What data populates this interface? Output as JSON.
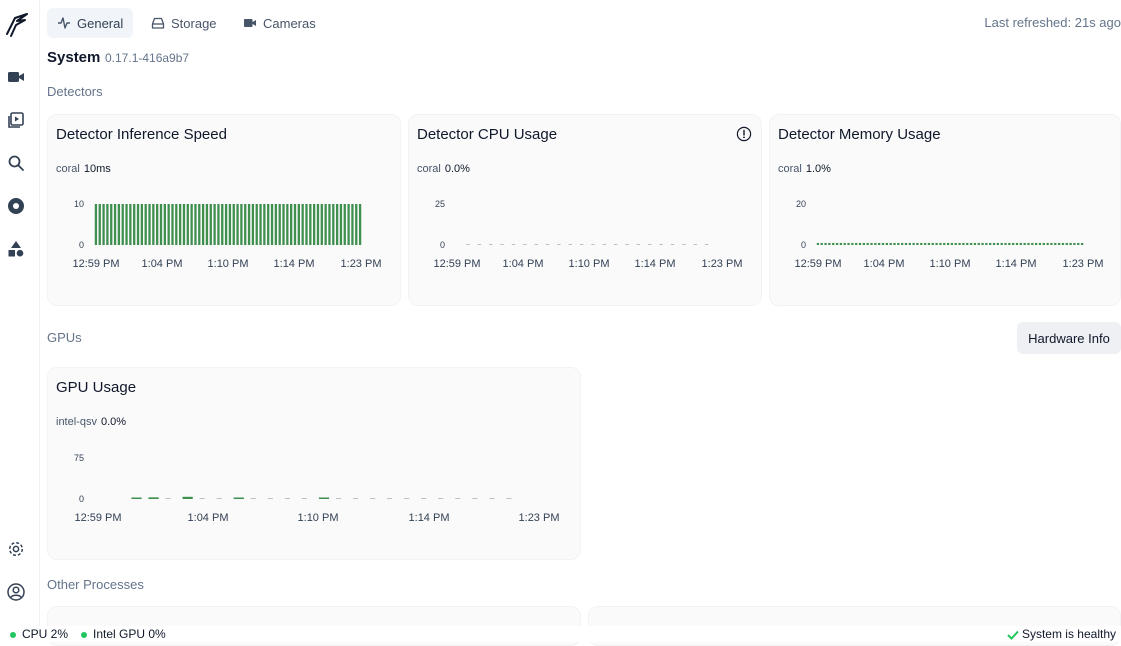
{
  "tabs": [
    {
      "label": "General",
      "icon": "activity-icon",
      "active": true
    },
    {
      "label": "Storage",
      "icon": "hard-drive-icon",
      "active": false
    },
    {
      "label": "Cameras",
      "icon": "camera-icon",
      "active": false
    }
  ],
  "last_refreshed": "Last refreshed: 21s ago",
  "system": {
    "title": "System",
    "version": "0.17.1-416a9b7"
  },
  "sections": {
    "detectors": "Detectors",
    "gpus": "GPUs",
    "other": "Other Processes"
  },
  "hardware_info_label": "Hardware Info",
  "colors": {
    "accent": "#3f8f4e",
    "healthy": "#22c55e"
  },
  "footer": {
    "cpu": "CPU 2%",
    "gpu": "Intel GPU 0%",
    "health": "System is healthy"
  },
  "chart_data": [
    {
      "type": "bar",
      "title": "Detector Inference Speed",
      "series": [
        {
          "name": "coral",
          "current": "10ms",
          "values": [
            10,
            10,
            10,
            10,
            10,
            10,
            10,
            10,
            10,
            10,
            10,
            10,
            10,
            10,
            10,
            10,
            10,
            10,
            10,
            10,
            10,
            10,
            10,
            10,
            10,
            10,
            10,
            10,
            10,
            10,
            10,
            10,
            10,
            10,
            10,
            10,
            10,
            10,
            10,
            10,
            10,
            10,
            10,
            10,
            10,
            10,
            10,
            10,
            10,
            10,
            10,
            10,
            10,
            10,
            10,
            10,
            10,
            10,
            10,
            10,
            10,
            10,
            10,
            10,
            10,
            10,
            10,
            10,
            10,
            10
          ]
        }
      ],
      "y_ticks": [
        "10",
        "0"
      ],
      "ylim": [
        0,
        10
      ],
      "x_ticks": [
        "12:59 PM",
        "1:04 PM",
        "1:10 PM",
        "1:14 PM",
        "1:23 PM"
      ]
    },
    {
      "type": "bar",
      "title": "Detector CPU Usage",
      "series": [
        {
          "name": "coral",
          "current": "0.0%",
          "values": [
            0,
            0,
            0,
            0,
            0,
            0,
            0,
            0,
            0,
            0,
            0,
            0,
            0,
            0,
            0,
            0,
            0,
            0,
            0,
            0,
            0,
            0
          ]
        }
      ],
      "y_ticks": [
        "25",
        "0"
      ],
      "ylim": [
        0,
        25
      ],
      "x_ticks": [
        "12:59 PM",
        "1:04 PM",
        "1:10 PM",
        "1:14 PM",
        "1:23 PM"
      ]
    },
    {
      "type": "bar",
      "title": "Detector Memory Usage",
      "series": [
        {
          "name": "coral",
          "current": "1.0%",
          "values": [
            1,
            1,
            1,
            1,
            1,
            1,
            1,
            1,
            1,
            1,
            1,
            1,
            1,
            1,
            1,
            1,
            1,
            1,
            1,
            1,
            1,
            1,
            1,
            1,
            1,
            1,
            1,
            1,
            1,
            1,
            1,
            1,
            1,
            1,
            1,
            1,
            1,
            1,
            1,
            1,
            1,
            1,
            1,
            1,
            1,
            1,
            1,
            1,
            1,
            1,
            1,
            1,
            1,
            1,
            1,
            1,
            1,
            1,
            1,
            1,
            1,
            1,
            1,
            1,
            1,
            1,
            1,
            1,
            1,
            1
          ]
        }
      ],
      "y_ticks": [
        "20",
        "0"
      ],
      "ylim": [
        0,
        20
      ],
      "x_ticks": [
        "12:59 PM",
        "1:04 PM",
        "1:10 PM",
        "1:14 PM",
        "1:23 PM"
      ]
    },
    {
      "type": "bar",
      "title": "GPU Usage",
      "series": [
        {
          "name": "intel-qsv",
          "current": "0.0%",
          "values": [
            2,
            3,
            0,
            4,
            0,
            0,
            2,
            0,
            0,
            0,
            0,
            2,
            0,
            0,
            0,
            0,
            0,
            0,
            0,
            0,
            0,
            0,
            0
          ]
        }
      ],
      "y_ticks": [
        "75",
        "0"
      ],
      "ylim": [
        0,
        75
      ],
      "x_ticks": [
        "12:59 PM",
        "1:04 PM",
        "1:10 PM",
        "1:14 PM",
        "1:23 PM"
      ]
    }
  ]
}
